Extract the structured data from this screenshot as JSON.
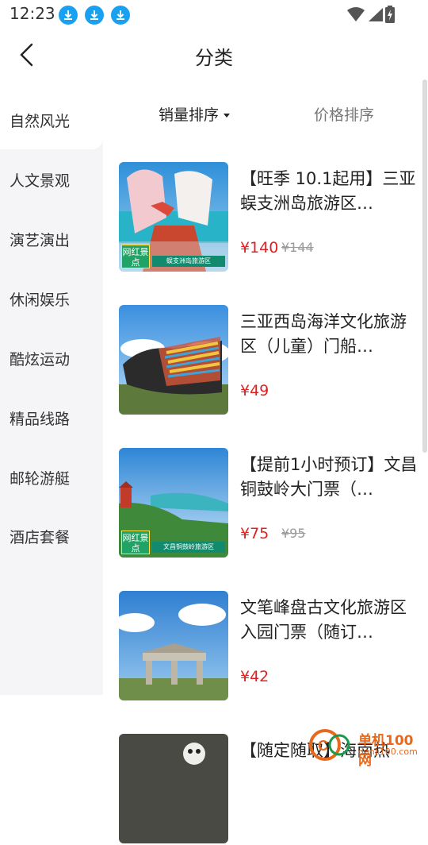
{
  "status": {
    "time": "12:23"
  },
  "header": {
    "title": "分类"
  },
  "sidebar": {
    "items": [
      {
        "label": "自然风光"
      },
      {
        "label": "人文景观"
      },
      {
        "label": "演艺演出"
      },
      {
        "label": "休闲娱乐"
      },
      {
        "label": "酷炫运动"
      },
      {
        "label": "精品线路"
      },
      {
        "label": "邮轮游艇"
      },
      {
        "label": "酒店套餐"
      }
    ]
  },
  "sort": {
    "sales_label": "销量排序",
    "price_label": "价格排序"
  },
  "products": [
    {
      "name": "【旺季 10.1起用】三亚蜈支洲岛旅游区…",
      "price": "¥140",
      "old_price": "¥144",
      "badge": "网红景点",
      "banner": "蜈支洲岛旅游区"
    },
    {
      "name": "三亚西岛海洋文化旅游区（儿童）门船…",
      "price": "¥49"
    },
    {
      "name": "【提前1小时预订】文昌铜鼓岭大门票（…",
      "price": "¥75",
      "old_price": "¥95",
      "badge": "网红景点",
      "banner": "文昌铜鼓岭旅游区"
    },
    {
      "name": "文笔峰盘古文化旅游区入园门票（随订…",
      "price": "¥42"
    },
    {
      "name": "【随定随取】海南热"
    }
  ],
  "watermark": {
    "text": "单机100网",
    "sub": "danji100.com"
  }
}
